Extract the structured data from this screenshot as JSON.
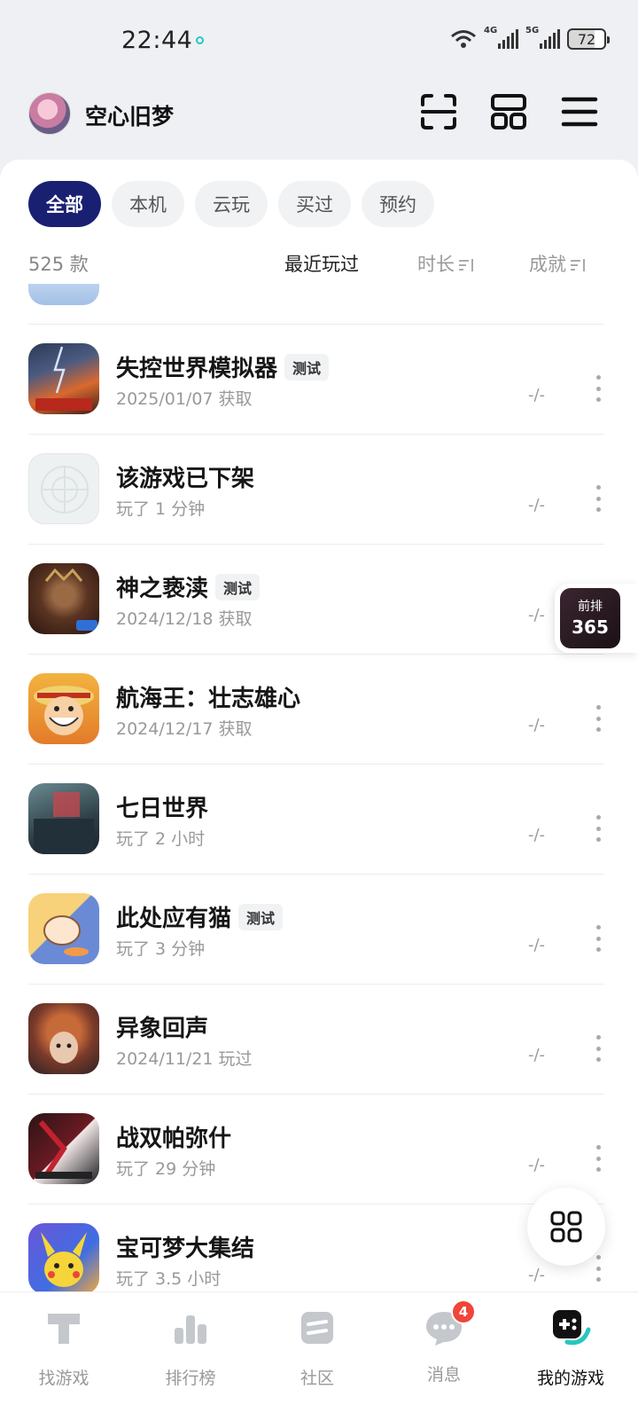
{
  "status_bar": {
    "time": "22:44",
    "net1": "4G",
    "net2": "5G",
    "battery": "72"
  },
  "header": {
    "username": "空心旧梦"
  },
  "filters": [
    {
      "label": "全部",
      "active": true
    },
    {
      "label": "本机",
      "active": false
    },
    {
      "label": "云玩",
      "active": false
    },
    {
      "label": "买过",
      "active": false
    },
    {
      "label": "预约",
      "active": false
    }
  ],
  "sortbar": {
    "count": "525 款",
    "sort_recent": "最近玩过",
    "sort_duration": "时长",
    "sort_achievement": "成就"
  },
  "games": [
    {
      "name": "失控世界模拟器",
      "badge": "测试",
      "sub": "2025/01/07 获取",
      "score": "-/-"
    },
    {
      "name": "该游戏已下架",
      "badge": "",
      "sub": "玩了 1 分钟",
      "score": "-/-"
    },
    {
      "name": "神之亵渎",
      "badge": "测试",
      "sub": "2024/12/18 获取",
      "score": "-/-"
    },
    {
      "name": "航海王：壮志雄心",
      "badge": "",
      "sub": "2024/12/17 获取",
      "score": "-/-"
    },
    {
      "name": "七日世界",
      "badge": "",
      "sub": "玩了 2 小时",
      "score": "-/-"
    },
    {
      "name": "此处应有猫",
      "badge": "测试",
      "sub": "玩了 3 分钟",
      "score": "-/-"
    },
    {
      "name": "异象回声",
      "badge": "",
      "sub": "2024/11/21 玩过",
      "score": "-/-"
    },
    {
      "name": "战双帕弥什",
      "badge": "",
      "sub": "玩了 29 分钟",
      "score": "-/-"
    },
    {
      "name": "宝可梦大集结",
      "badge": "",
      "sub": "玩了 3.5 小时",
      "score": "-/-"
    }
  ],
  "side_badge": {
    "line1": "前排",
    "line2": "365"
  },
  "tabs": [
    {
      "label": "找游戏",
      "icon": "find-game-icon"
    },
    {
      "label": "排行榜",
      "icon": "ranking-icon"
    },
    {
      "label": "社区",
      "icon": "community-icon"
    },
    {
      "label": "消息",
      "icon": "message-icon",
      "badge": "4"
    },
    {
      "label": "我的游戏",
      "icon": "my-games-icon",
      "active": true
    }
  ],
  "colors": {
    "accent": "#1a2071",
    "badge_red": "#f0453a",
    "teal": "#24c7c0"
  }
}
